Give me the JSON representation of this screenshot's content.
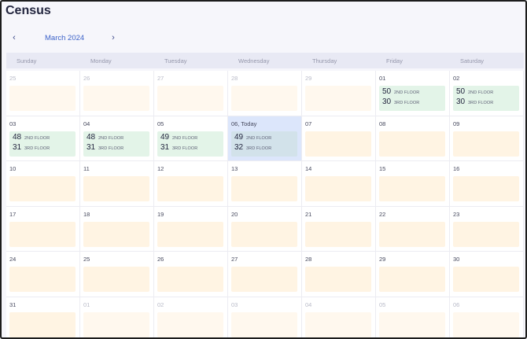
{
  "page_title": "Census",
  "nav": {
    "month_label": "March 2024",
    "prev_icon": "‹",
    "next_icon": "›"
  },
  "weekdays": [
    "Sunday",
    "Monday",
    "Tuesday",
    "Wednesday",
    "Thursday",
    "Friday",
    "Saturday"
  ],
  "floor_labels": {
    "second": "2ND FLOOR",
    "third": "3RD FLOOR"
  },
  "weeks": [
    [
      {
        "date": "25",
        "outside": true
      },
      {
        "date": "26",
        "outside": true
      },
      {
        "date": "27",
        "outside": true
      },
      {
        "date": "28",
        "outside": true
      },
      {
        "date": "29",
        "outside": true
      },
      {
        "date": "01",
        "second": "50",
        "third": "30"
      },
      {
        "date": "02",
        "second": "50",
        "third": "30"
      }
    ],
    [
      {
        "date": "03",
        "second": "48",
        "third": "31"
      },
      {
        "date": "04",
        "second": "48",
        "third": "31"
      },
      {
        "date": "05",
        "second": "49",
        "third": "31"
      },
      {
        "date": "06, Today",
        "today": true,
        "second": "49",
        "third": "32"
      },
      {
        "date": "07"
      },
      {
        "date": "08"
      },
      {
        "date": "09"
      }
    ],
    [
      {
        "date": "10"
      },
      {
        "date": "11"
      },
      {
        "date": "12"
      },
      {
        "date": "13"
      },
      {
        "date": "14"
      },
      {
        "date": "15"
      },
      {
        "date": "16"
      }
    ],
    [
      {
        "date": "17"
      },
      {
        "date": "18"
      },
      {
        "date": "19"
      },
      {
        "date": "20"
      },
      {
        "date": "21"
      },
      {
        "date": "22"
      },
      {
        "date": "23"
      }
    ],
    [
      {
        "date": "24"
      },
      {
        "date": "25"
      },
      {
        "date": "26"
      },
      {
        "date": "27"
      },
      {
        "date": "28"
      },
      {
        "date": "29"
      },
      {
        "date": "30"
      }
    ],
    [
      {
        "date": "31"
      },
      {
        "date": "01",
        "outside": true
      },
      {
        "date": "02",
        "outside": true
      },
      {
        "date": "03",
        "outside": true
      },
      {
        "date": "04",
        "outside": true
      },
      {
        "date": "05",
        "outside": true
      },
      {
        "date": "06",
        "outside": true
      }
    ]
  ]
}
